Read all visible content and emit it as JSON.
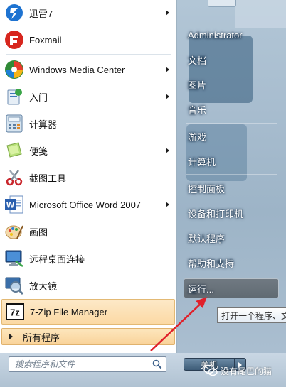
{
  "programs": [
    {
      "label": "迅雷7",
      "icon": "thunder-icon",
      "has_submenu": true
    },
    {
      "label": "Foxmail",
      "icon": "foxmail-icon",
      "has_submenu": false
    },
    {
      "label": "Windows Media Center",
      "icon": "media-center-icon",
      "has_submenu": true
    },
    {
      "label": "入门",
      "icon": "getting-started-icon",
      "has_submenu": true
    },
    {
      "label": "计算器",
      "icon": "calculator-icon",
      "has_submenu": false
    },
    {
      "label": "便笺",
      "icon": "sticky-notes-icon",
      "has_submenu": true
    },
    {
      "label": "截图工具",
      "icon": "snipping-tool-icon",
      "has_submenu": false
    },
    {
      "label": "Microsoft Office Word 2007",
      "icon": "word-icon",
      "has_submenu": true
    },
    {
      "label": "画图",
      "icon": "paint-icon",
      "has_submenu": false
    },
    {
      "label": "远程桌面连接",
      "icon": "remote-desktop-icon",
      "has_submenu": false
    },
    {
      "label": "放大镜",
      "icon": "magnifier-icon",
      "has_submenu": false
    },
    {
      "label": "7-Zip File Manager",
      "icon": "7zip-icon",
      "has_submenu": false,
      "highlighted": true
    }
  ],
  "all_programs_label": "所有程序",
  "search": {
    "placeholder": "搜索程序和文件"
  },
  "right_menu": {
    "user": "Administrator",
    "documents": "文档",
    "pictures": "图片",
    "music": "音乐",
    "games": "游戏",
    "computer": "计算机",
    "control_panel": "控制面板",
    "devices_printers": "设备和打印机",
    "default_programs": "默认程序",
    "help_support": "帮助和支持",
    "run": "运行..."
  },
  "shutdown_label": "关机",
  "tooltip_text": "打开一个程序、文",
  "watermark_text": "没有尾巴的猫",
  "colors": {
    "highlight": "#fbd9a4",
    "annotation_arrow": "#e0202a",
    "glass": "#a8bdcf"
  }
}
